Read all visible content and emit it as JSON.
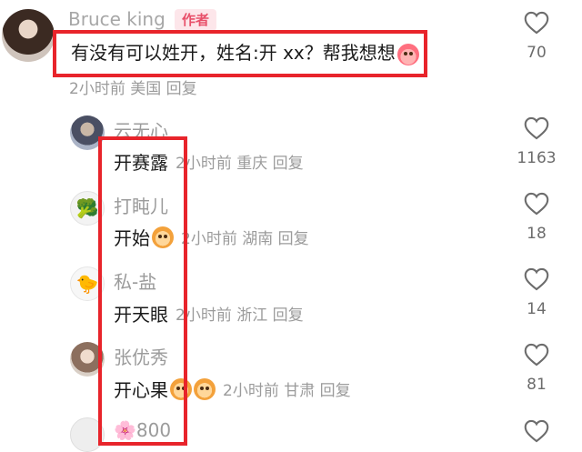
{
  "main_comment": {
    "author": "Bruce king",
    "author_badge": "作者",
    "text": "有没有可以姓开，姓名:开 xx？帮我想想",
    "meta": "2小时前 美国 回复",
    "likes": "70"
  },
  "replies": [
    {
      "author": "云无心",
      "text": "开赛露",
      "meta": "2小时前 重庆 回复",
      "likes": "1163"
    },
    {
      "author": "打盹儿",
      "text": "开始",
      "meta": "2小时前 湖南 回复",
      "likes": "18"
    },
    {
      "author": "私-盐",
      "text": "开天眼",
      "meta": "2小时前 浙江 回复",
      "likes": "14"
    },
    {
      "author": "张优秀",
      "text": "开心果",
      "meta": "2小时前 甘肃 回复",
      "likes": "81"
    },
    {
      "author": "🌸800",
      "text": "",
      "meta": "",
      "likes": ""
    }
  ],
  "icons": {
    "heart": "heart-outline",
    "highlight_color": "#e8242b"
  }
}
